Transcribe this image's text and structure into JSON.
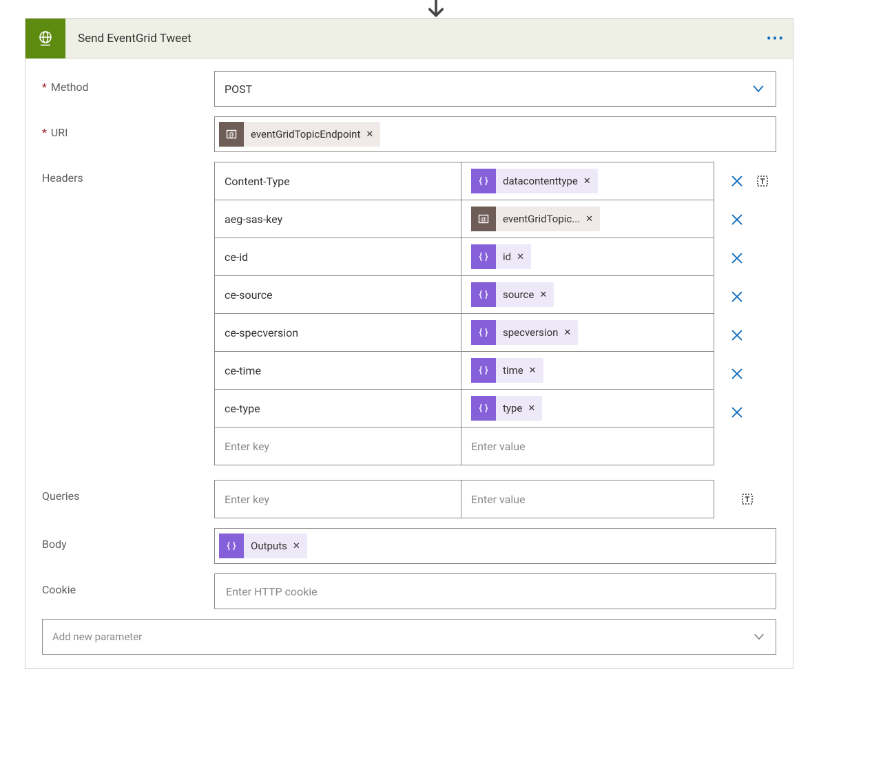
{
  "action": {
    "title": "Send EventGrid Tweet"
  },
  "fields": {
    "method": {
      "label": "Method",
      "value": "POST"
    },
    "uri": {
      "label": "URI",
      "tokens": [
        {
          "label": "eventGridTopicEndpoint",
          "icon": "[@]",
          "style": "brown"
        }
      ]
    },
    "headers": {
      "label": "Headers",
      "rows": [
        {
          "key": "Content-Type",
          "val": {
            "label": "datacontenttype",
            "icon": "{ }",
            "style": "purple"
          }
        },
        {
          "key": "aeg-sas-key",
          "val": {
            "label": "eventGridTopic...",
            "icon": "[@]",
            "style": "brown"
          }
        },
        {
          "key": "ce-id",
          "val": {
            "label": "id",
            "icon": "{ }",
            "style": "purple"
          }
        },
        {
          "key": "ce-source",
          "val": {
            "label": "source",
            "icon": "{ }",
            "style": "purple"
          }
        },
        {
          "key": "ce-specversion",
          "val": {
            "label": "specversion",
            "icon": "{ }",
            "style": "purple"
          }
        },
        {
          "key": "ce-time",
          "val": {
            "label": "time",
            "icon": "{ }",
            "style": "purple"
          }
        },
        {
          "key": "ce-type",
          "val": {
            "label": "type",
            "icon": "{ }",
            "style": "purple"
          }
        }
      ],
      "placeholder_key": "Enter key",
      "placeholder_val": "Enter value"
    },
    "queries": {
      "label": "Queries",
      "placeholder_key": "Enter key",
      "placeholder_val": "Enter value"
    },
    "body": {
      "label": "Body",
      "tokens": [
        {
          "label": "Outputs",
          "icon": "{ }",
          "style": "purple"
        }
      ]
    },
    "cookie": {
      "label": "Cookie",
      "placeholder": "Enter HTTP cookie"
    }
  },
  "addParam": "Add new parameter"
}
